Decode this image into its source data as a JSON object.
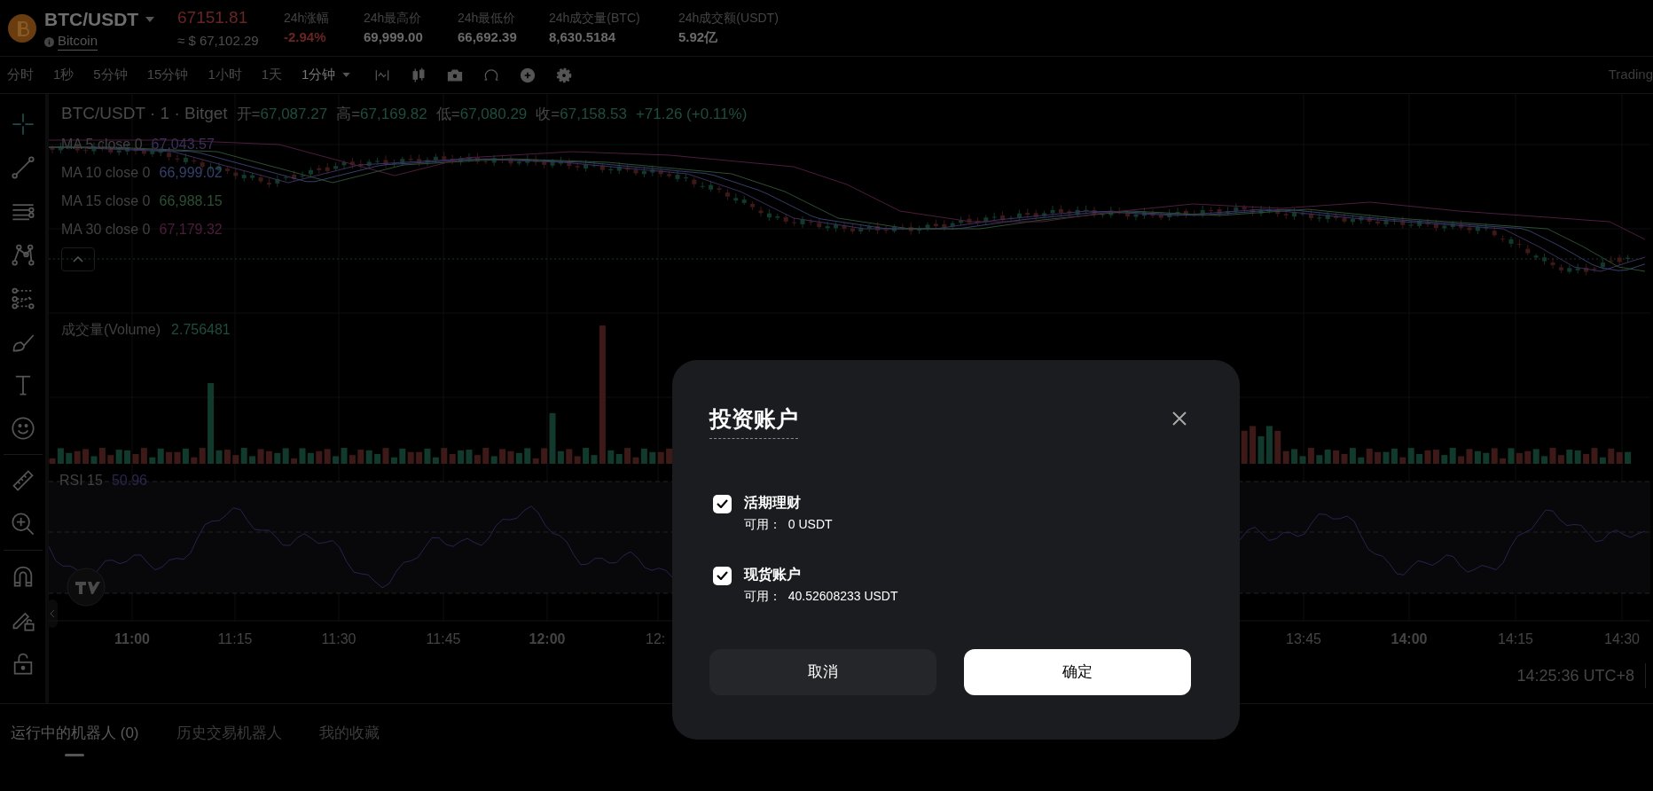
{
  "header": {
    "symbol": "BTC/USDT",
    "coin_name": "Bitcoin",
    "last_price": "67151.81",
    "price_usd": "≈ $ 67,102.29",
    "stats": [
      {
        "label": "24h涨幅",
        "value": "-2.94%",
        "kind": "down"
      },
      {
        "label": "24h最高价",
        "value": "69,999.00",
        "kind": "plain"
      },
      {
        "label": "24h最低价",
        "value": "66,692.39",
        "kind": "plain"
      },
      {
        "label": "24h成交量(BTC)",
        "value": "8,630.5184",
        "kind": "plain"
      },
      {
        "label": "24h成交额(USDT)",
        "value": "5.92亿",
        "kind": "plain"
      }
    ]
  },
  "intervals": [
    {
      "label": "分时",
      "selected": false,
      "has_menu": false
    },
    {
      "label": "1秒",
      "selected": false,
      "has_menu": false
    },
    {
      "label": "5分钟",
      "selected": false,
      "has_menu": false
    },
    {
      "label": "15分钟",
      "selected": false,
      "has_menu": false
    },
    {
      "label": "1小时",
      "selected": false,
      "has_menu": false
    },
    {
      "label": "1天",
      "selected": false,
      "has_menu": false
    },
    {
      "label": "1分钟",
      "selected": true,
      "has_menu": true
    }
  ],
  "toolbar_brand": "Trading",
  "chart": {
    "legend": {
      "title": "BTC/USDT · 1 · Bitget",
      "ohlc": [
        {
          "label": "开=",
          "value": "67,087.27"
        },
        {
          "label": "高=",
          "value": "67,169.82"
        },
        {
          "label": "低=",
          "value": "67,080.29"
        },
        {
          "label": "收=",
          "value": "67,158.53"
        }
      ],
      "change": "+71.26 (+0.11%)"
    },
    "moving_averages": [
      {
        "label": "MA 5 close 0",
        "value": "67,043.57",
        "color": "#3d2f5c"
      },
      {
        "label": "MA 10 close 0",
        "value": "66,999.02",
        "color": "#34406a"
      },
      {
        "label": "MA 15 close 0",
        "value": "66,988.15",
        "color": "#2c4f33"
      },
      {
        "label": "MA 30 close 0",
        "value": "67,179.32",
        "color": "#4e1d3c"
      }
    ],
    "volume": {
      "label": "成交量(Volume)",
      "value": "2.756481"
    },
    "rsi": {
      "label": "RSI 15",
      "value": "50.96"
    },
    "time_axis": [
      {
        "label": "11:00",
        "bold": true
      },
      {
        "label": "11:15",
        "bold": false
      },
      {
        "label": "11:30",
        "bold": false
      },
      {
        "label": "11:45",
        "bold": false
      },
      {
        "label": "12:00",
        "bold": true
      },
      {
        "label": "12:",
        "bold": false
      },
      {
        "label": "13:45",
        "bold": false
      },
      {
        "label": "14:00",
        "bold": true
      },
      {
        "label": "14:15",
        "bold": false
      },
      {
        "label": "14:30",
        "bold": false
      }
    ],
    "clock": "14:25:36 UTC+8"
  },
  "bottom_tabs": [
    {
      "label": "运行中的机器人 (0)",
      "selected": true
    },
    {
      "label": "历史交易机器人",
      "selected": false
    },
    {
      "label": "我的收藏",
      "selected": false
    }
  ],
  "dialog": {
    "title": "投资账户",
    "accounts": [
      {
        "name": "活期理财",
        "available": "可用：  0 USDT",
        "checked": true
      },
      {
        "name": "现货账户",
        "available": "可用：  40.52608233 USDT",
        "checked": true
      }
    ],
    "cancel": "取消",
    "confirm": "确定"
  }
}
